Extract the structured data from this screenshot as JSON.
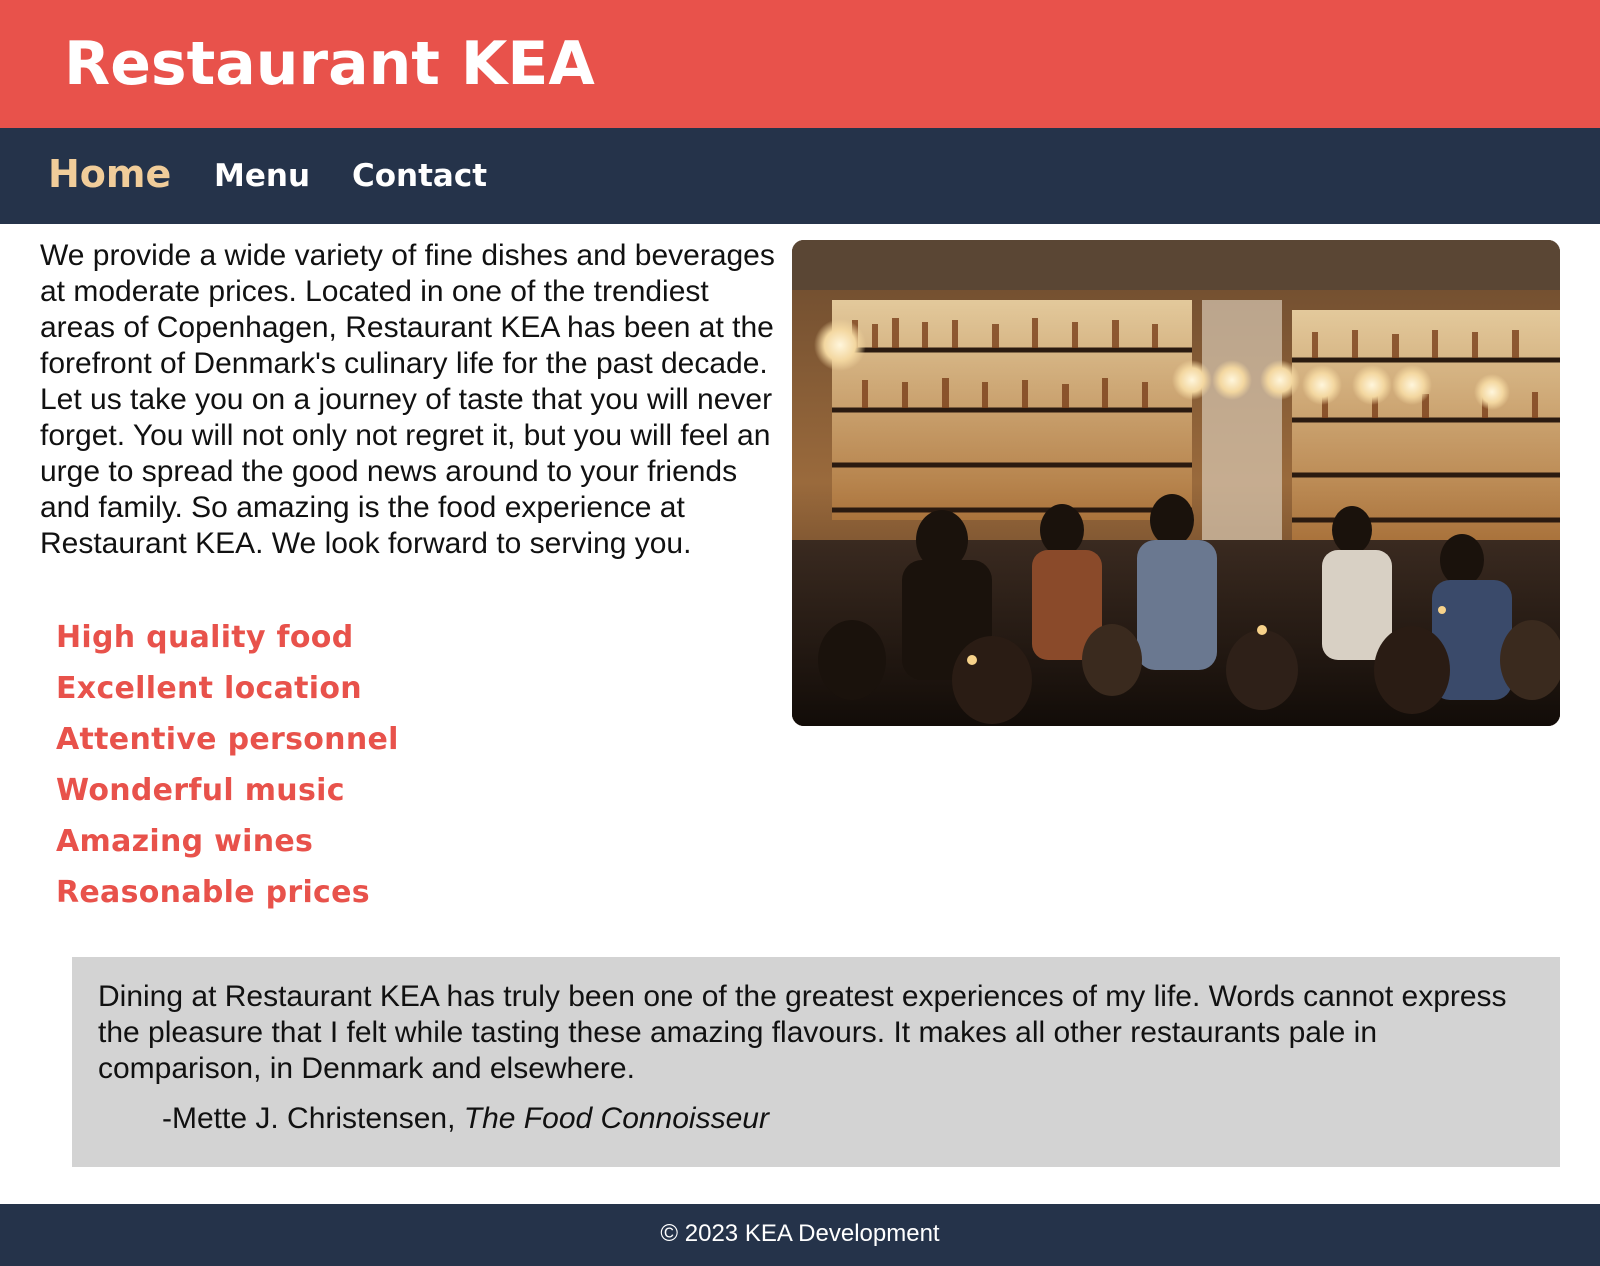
{
  "header": {
    "title": "Restaurant KEA"
  },
  "nav": {
    "items": [
      {
        "label": "Home",
        "active": true
      },
      {
        "label": "Menu",
        "active": false
      },
      {
        "label": "Contact",
        "active": false
      }
    ]
  },
  "main": {
    "intro": "We provide a wide variety of fine dishes and beverages at moderate prices. Located in one of the trendiest areas of Copenhagen, Restaurant KEA has been at the forefront of Denmark's culinary life for the past decade. Let us take you on a journey of taste that you will never forget. You will not only not regret it, but you will feel an urge to spread the good news around to your friends and family. So amazing is the food experience at Restaurant KEA. We look forward to serving you.",
    "features": [
      "High quality food",
      "Excellent location",
      "Attentive personnel",
      "Wonderful music",
      "Amazing wines",
      "Reasonable prices"
    ]
  },
  "testimonial": {
    "quote": "Dining at Restaurant KEA has truly been one of the greatest experiences of my life. Words cannot express the pleasure that I felt while tasting these amazing flavours. It makes all other restaurants pale in comparison, in Denmark and elsewhere.",
    "author_prefix": "-Mette J. Christensen, ",
    "source": "The Food Connoisseur"
  },
  "footer": {
    "text": "© 2023 KEA Development"
  },
  "colors": {
    "header_bg": "#e8524b",
    "nav_bg": "#25334a",
    "nav_active": "#f1cd9a",
    "accent": "#e8524b",
    "testimonial_bg": "#d3d3d3"
  }
}
